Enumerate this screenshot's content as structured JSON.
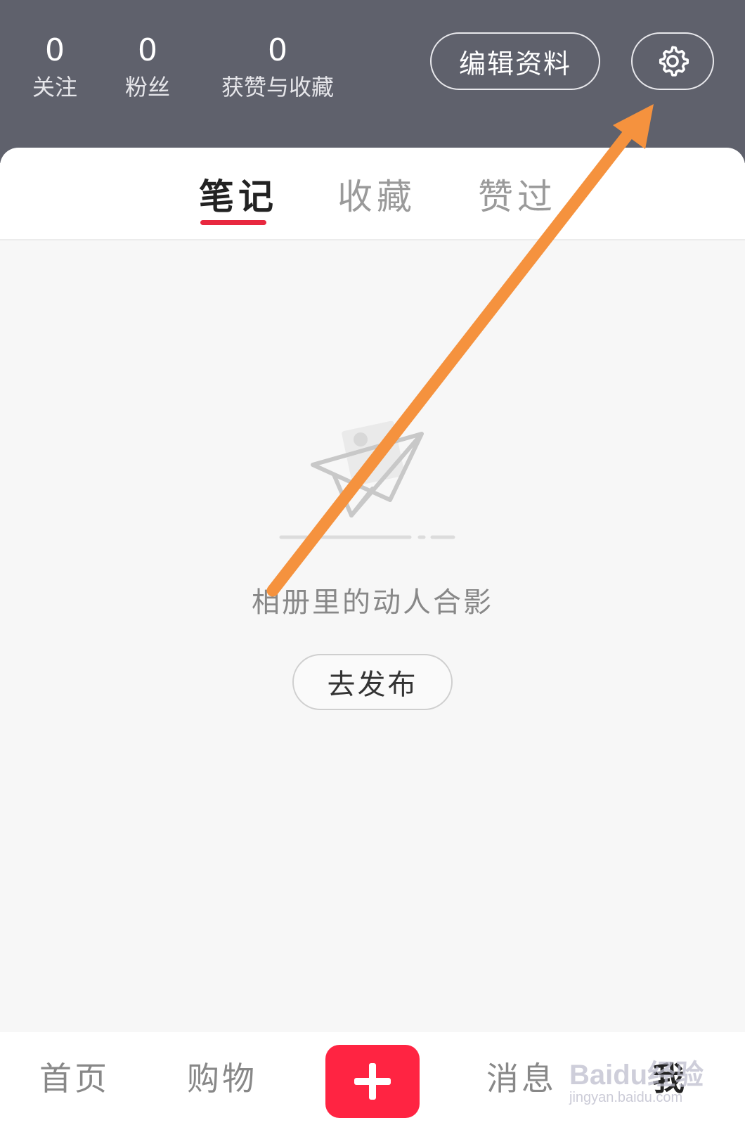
{
  "header": {
    "stats": [
      {
        "count": "0",
        "label": "关注"
      },
      {
        "count": "0",
        "label": "粉丝"
      },
      {
        "count": "0",
        "label": "获赞与收藏"
      }
    ],
    "edit_profile_label": "编辑资料",
    "settings_icon": "gear-icon",
    "background_color": "#5f616c"
  },
  "tabs": [
    {
      "label": "笔记",
      "active": true
    },
    {
      "label": "收藏",
      "active": false
    },
    {
      "label": "赞过",
      "active": false
    }
  ],
  "empty_state": {
    "illustration_icon": "paper-plane-icon",
    "message": "相册里的动人合影",
    "action_label": "去发布"
  },
  "bottom_nav": {
    "items": [
      {
        "label": "首页",
        "active": false
      },
      {
        "label": "购物",
        "active": false
      },
      {
        "label": "消息",
        "active": false
      },
      {
        "label": "我",
        "active": true
      }
    ],
    "plus_icon": "plus-icon",
    "accent_color": "#ff2442"
  },
  "watermark": {
    "text": "Baidu经验",
    "sub": "jingyan.baidu.com"
  },
  "annotation": {
    "type": "arrow",
    "color": "#f5923e",
    "points_to": "settings-button"
  }
}
